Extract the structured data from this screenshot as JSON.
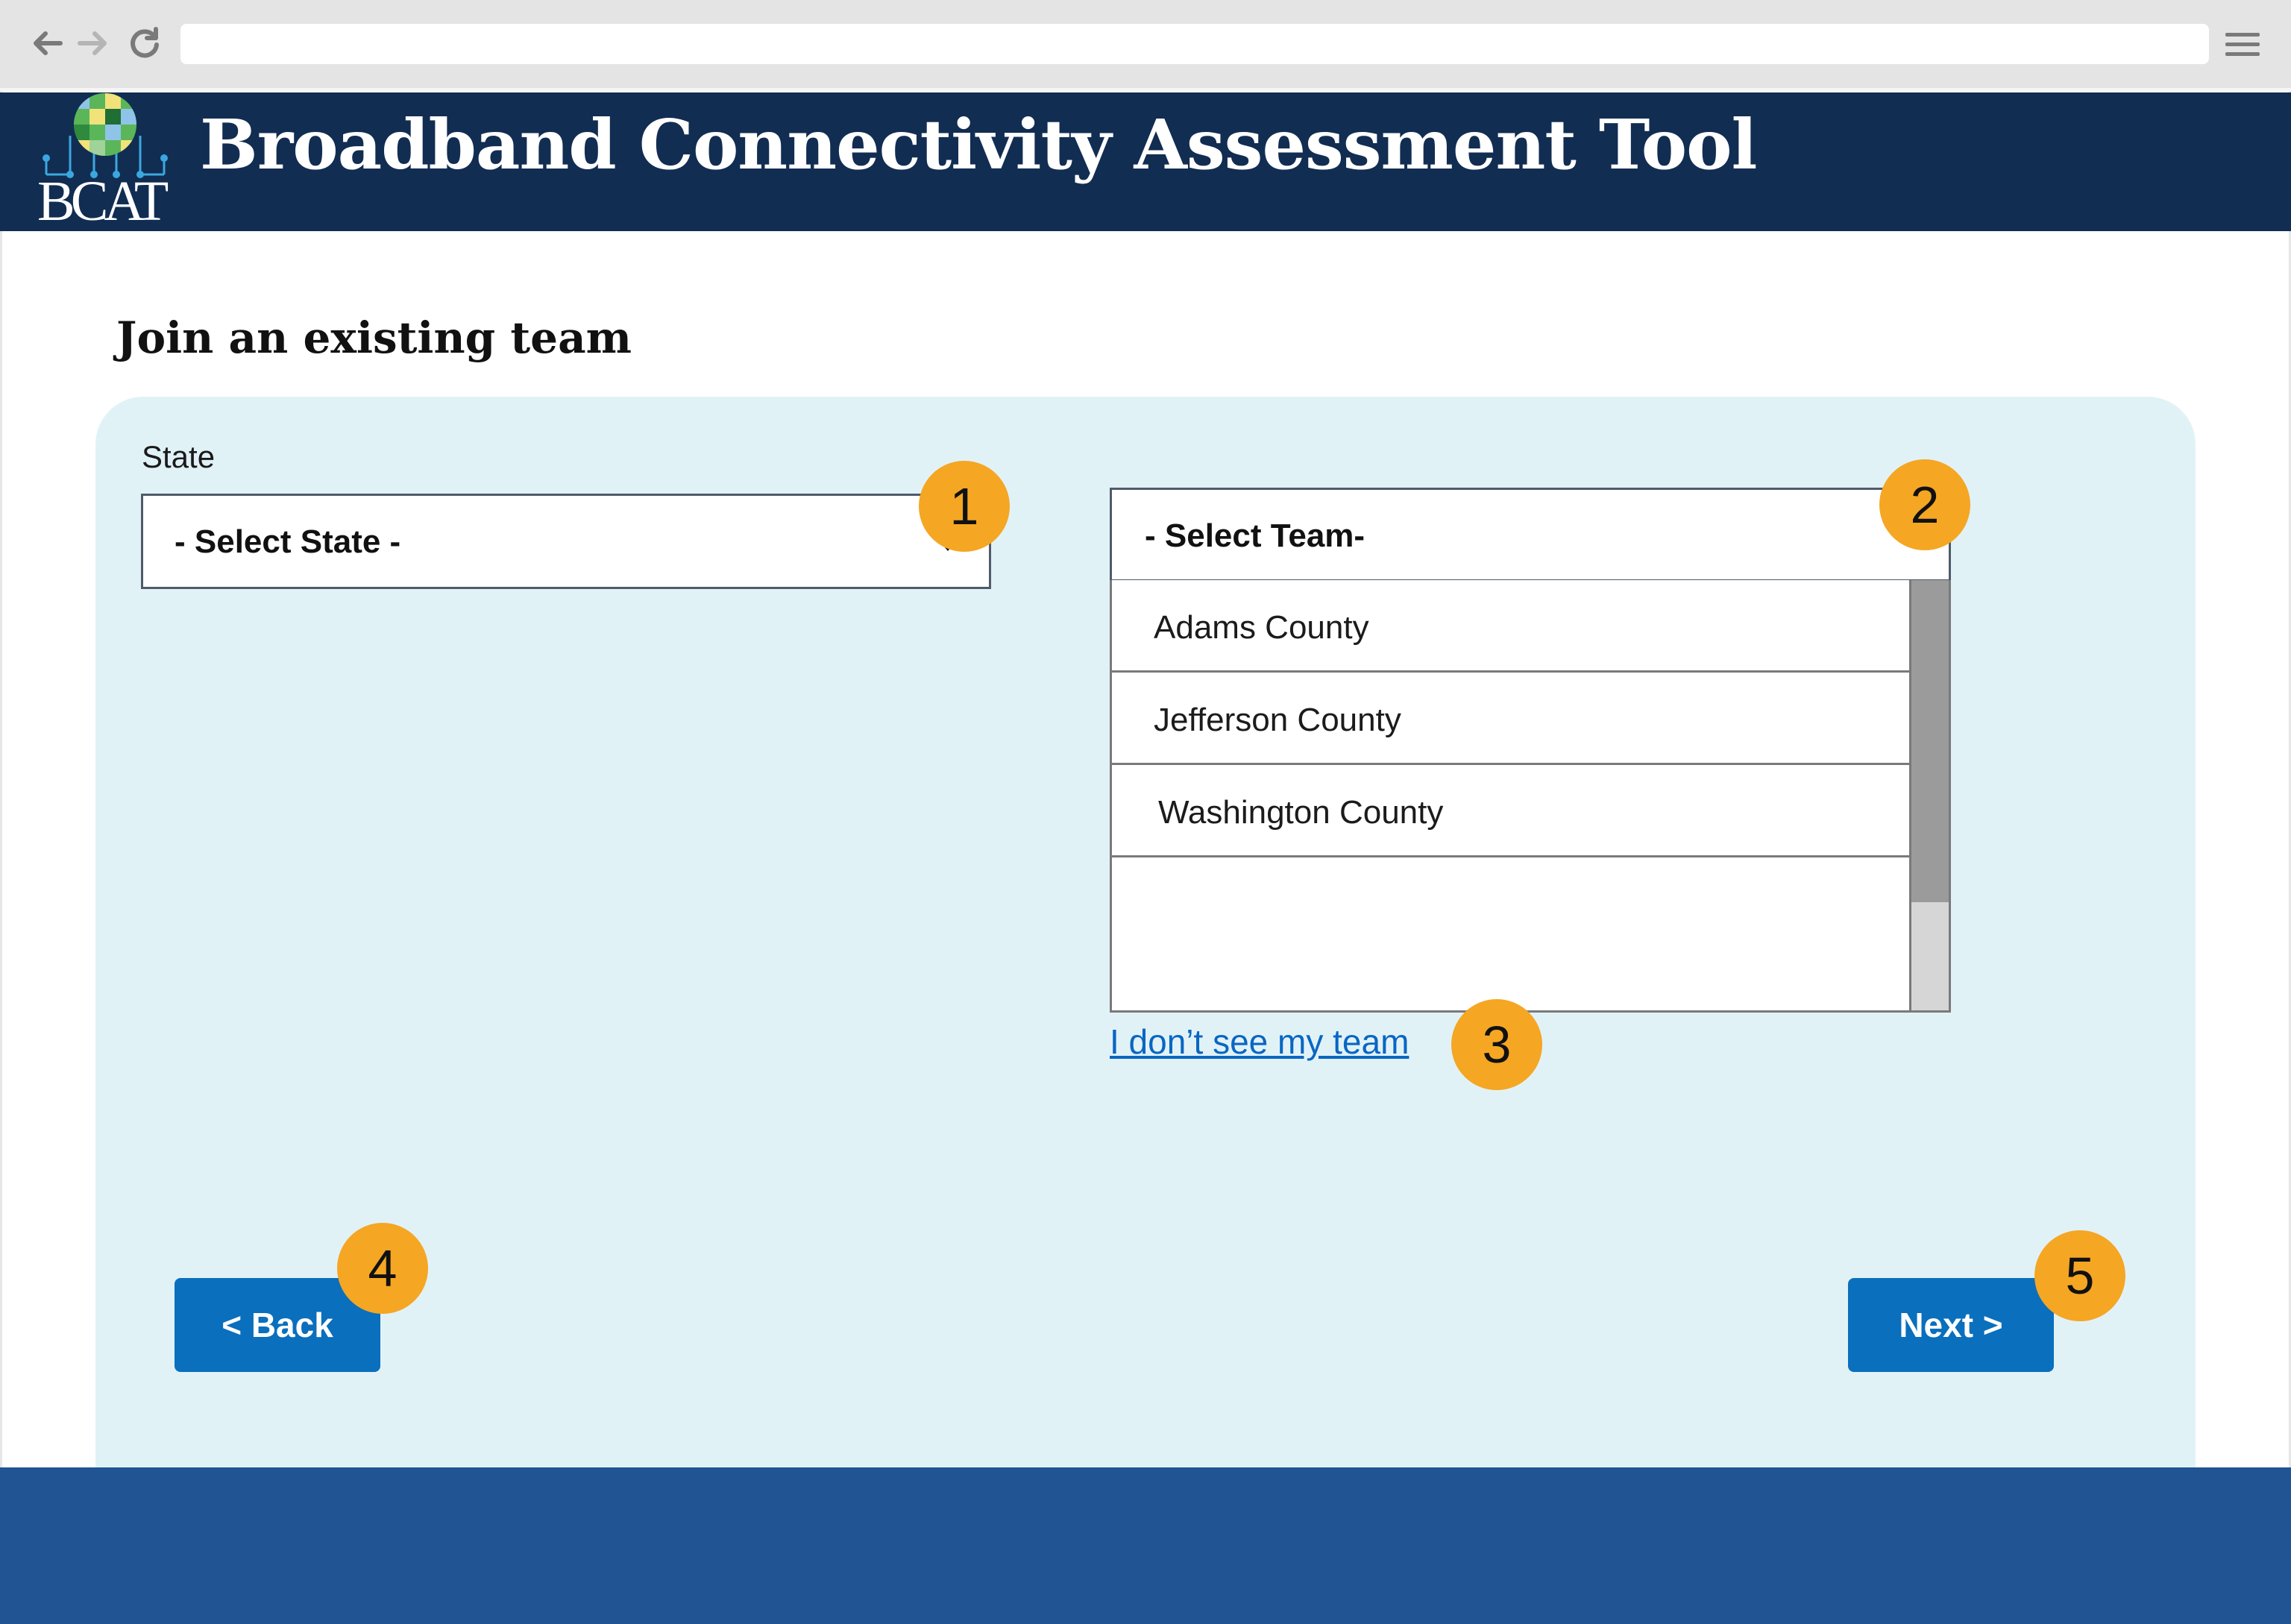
{
  "browser": {
    "back_icon": "arrow-left-icon",
    "forward_icon": "arrow-right-icon",
    "reload_icon": "reload-icon",
    "menu_icon": "hamburger-menu-icon",
    "address_value": ""
  },
  "header": {
    "logo_text": "BCAT",
    "title": "Broadband Connectivity Assessment Tool",
    "background_color": "#122d52"
  },
  "page": {
    "title": "Join an existing team"
  },
  "form": {
    "state_label": "State",
    "state_select_value": "- Select State -",
    "team_select_value": "- Select Team-",
    "team_options": [
      "Adams County",
      "Jefferson County",
      "Washington County"
    ],
    "missing_team_link": "I don’t see my team",
    "panel_color": "#e1f2f7"
  },
  "buttons": {
    "back_label": "< Back",
    "next_label": "Next >",
    "color": "#0a6fbd"
  },
  "callouts": [
    "1",
    "2",
    "3",
    "4",
    "5"
  ],
  "callout_color": "#f5a623",
  "footer_color": "#205493"
}
